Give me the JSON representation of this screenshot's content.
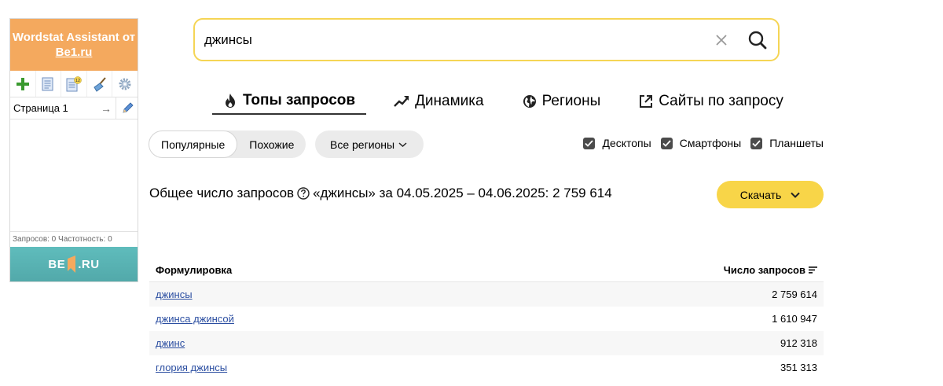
{
  "widget": {
    "title_line1": "Wordstat Assistant от",
    "title_link": "Be1.ru",
    "page_name": "Страница 1",
    "page_arrow": "→",
    "stats": "Запросов: 0  Частотность: 0",
    "footer_left": "BE",
    "footer_right": ".RU",
    "icons": [
      "plus-icon",
      "document-icon",
      "document-badge-icon",
      "broom-icon",
      "gear-icon"
    ],
    "badge_count": "12"
  },
  "search": {
    "value": "джинсы"
  },
  "tabs": [
    {
      "label": "Топы запросов",
      "icon": "fire-icon",
      "active": true
    },
    {
      "label": "Динамика",
      "icon": "trend-icon",
      "active": false
    },
    {
      "label": "Регионы",
      "icon": "globe-icon",
      "active": false
    },
    {
      "label": "Сайты по запросу",
      "icon": "external-link-icon",
      "active": false
    }
  ],
  "filters": {
    "popular": "Популярные",
    "similar": "Похожие",
    "region": "Все регионы",
    "devices": [
      {
        "label": "Десктопы",
        "checked": true
      },
      {
        "label": "Смартфоны",
        "checked": true
      },
      {
        "label": "Планшеты",
        "checked": true
      }
    ]
  },
  "summary": {
    "prefix": "Общее число запросов",
    "suffix": "«джинсы» за 04.05.2025 – 04.06.2025: 2 759 614",
    "download": "Скачать"
  },
  "table": {
    "col_phrase": "Формулировка",
    "col_count": "Число запросов",
    "rows": [
      {
        "phrase": "джинсы",
        "count": "2 759 614"
      },
      {
        "phrase": "джинса джинсой",
        "count": "1 610 947"
      },
      {
        "phrase": "джинс",
        "count": "912 318"
      },
      {
        "phrase": "глория джинсы",
        "count": "351 313"
      }
    ]
  },
  "colors": {
    "accent_yellow": "#f8d548",
    "search_border": "#f5d555",
    "widget_header": "#f4a95e",
    "widget_footer": "#5fbcbc",
    "link": "#2b4ea1"
  }
}
